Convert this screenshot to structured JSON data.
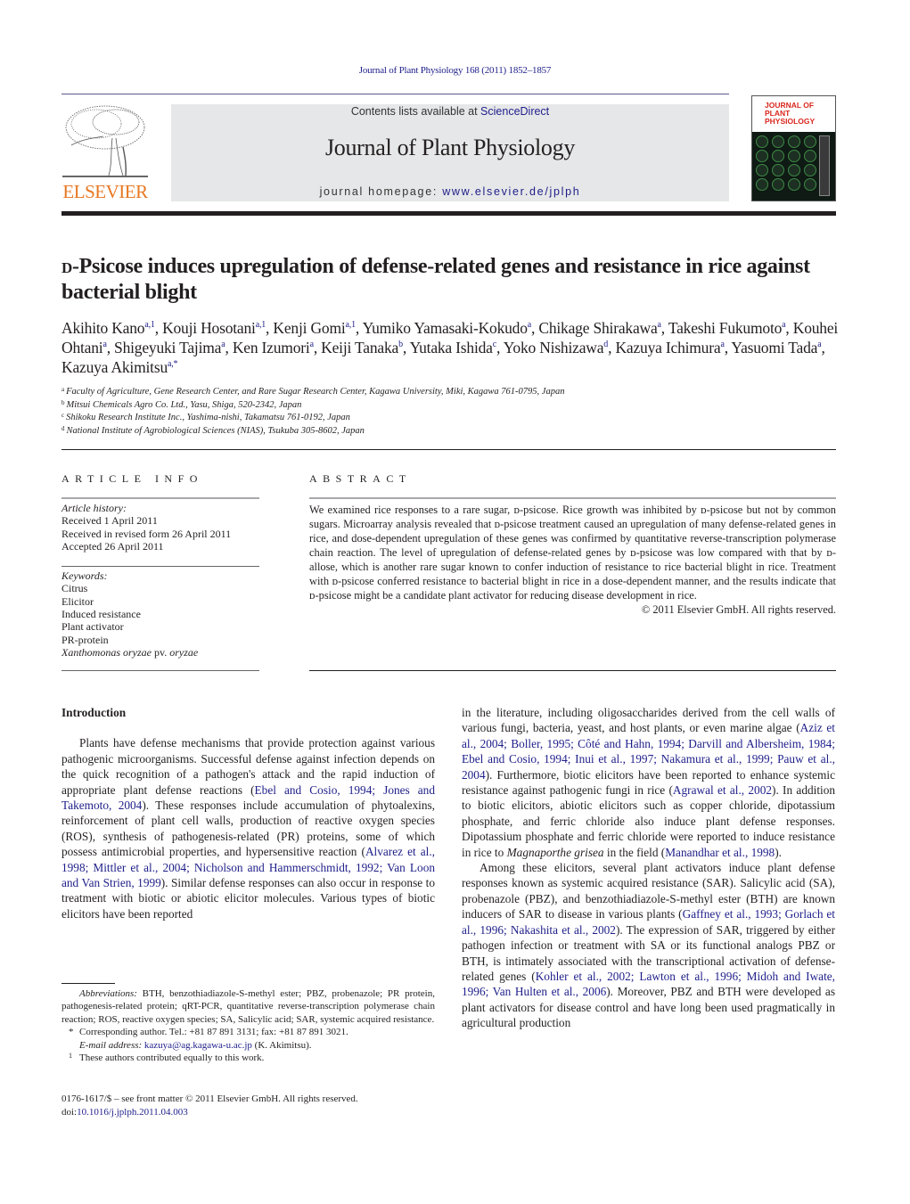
{
  "running_head": "Journal of Plant Physiology 168 (2011) 1852–1857",
  "masthead": {
    "publisher_logo": "ELSEVIER",
    "contents_prefix": "Contents lists available at ",
    "contents_link": "ScienceDirect",
    "journal_name": "Journal of Plant Physiology",
    "homepage_prefix": "journal homepage: ",
    "homepage_link": "www.elsevier.de/jplph",
    "cover_title": "JOURNAL OF PLANT PHYSIOLOGY"
  },
  "article": {
    "title_sc": "d",
    "title_rest": "-Psicose induces upregulation of defense-related genes and resistance in rice against bacterial blight",
    "authors": [
      {
        "name": "Akihito Kano",
        "aff": "a,1"
      },
      {
        "name": "Kouji Hosotani",
        "aff": "a,1"
      },
      {
        "name": "Kenji Gomi",
        "aff": "a,1"
      },
      {
        "name": "Yumiko Yamasaki-Kokudo",
        "aff": "a"
      },
      {
        "name": "Chikage Shirakawa",
        "aff": "a"
      },
      {
        "name": "Takeshi Fukumoto",
        "aff": "a"
      },
      {
        "name": "Kouhei Ohtani",
        "aff": "a"
      },
      {
        "name": "Shigeyuki Tajima",
        "aff": "a"
      },
      {
        "name": "Ken Izumori",
        "aff": "a"
      },
      {
        "name": "Keiji Tanaka",
        "aff": "b"
      },
      {
        "name": "Yutaka Ishida",
        "aff": "c"
      },
      {
        "name": "Yoko Nishizawa",
        "aff": "d"
      },
      {
        "name": "Kazuya Ichimura",
        "aff": "a"
      },
      {
        "name": "Yasuomi Tada",
        "aff": "a"
      },
      {
        "name": "Kazuya Akimitsu",
        "aff": "a,*"
      }
    ],
    "affiliations": [
      {
        "mark": "a",
        "text": "Faculty of Agriculture, Gene Research Center, and Rare Sugar Research Center, Kagawa University, Miki, Kagawa 761-0795, Japan"
      },
      {
        "mark": "b",
        "text": "Mitsui Chemicals Agro Co. Ltd., Yasu, Shiga, 520-2342, Japan"
      },
      {
        "mark": "c",
        "text": "Shikoku Research Institute Inc., Yashima-nishi, Takamatsu 761-0192, Japan"
      },
      {
        "mark": "d",
        "text": "National Institute of Agrobiological Sciences (NIAS), Tsukuba 305-8602, Japan"
      }
    ]
  },
  "article_info": {
    "heading": "ARTICLE INFO",
    "history_label": "Article history:",
    "history": [
      "Received 1 April 2011",
      "Received in revised form 26 April 2011",
      "Accepted 26 April 2011"
    ],
    "keywords_label": "Keywords:",
    "keywords": [
      "Citrus",
      "Elicitor",
      "Induced resistance",
      "Plant activator",
      "PR-protein"
    ],
    "keyword_last_italic": "Xanthomonas oryzae",
    "keyword_last_plain": " pv. ",
    "keyword_last_italic2": "oryzae"
  },
  "abstract": {
    "heading": "ABSTRACT",
    "text": "We examined rice responses to a rare sugar, ᴅ-psicose. Rice growth was inhibited by ᴅ-psicose but not by common sugars. Microarray analysis revealed that ᴅ-psicose treatment caused an upregulation of many defense-related genes in rice, and dose-dependent upregulation of these genes was confirmed by quantitative reverse-transcription polymerase chain reaction. The level of upregulation of defense-related genes by ᴅ-psicose was low compared with that by ᴅ-allose, which is another rare sugar known to confer induction of resistance to rice bacterial blight in rice. Treatment with ᴅ-psicose conferred resistance to bacterial blight in rice in a dose-dependent manner, and the results indicate that ᴅ-psicose might be a candidate plant activator for reducing disease development in rice.",
    "copyright": "© 2011 Elsevier GmbH. All rights reserved."
  },
  "body": {
    "intro_heading": "Introduction",
    "p1": [
      {
        "t": "Plants have defense mechanisms that provide protection against various pathogenic microorganisms. Successful defense against infection depends on the quick recognition of a pathogen's attack and the rapid induction of appropriate plant defense reactions ("
      },
      {
        "l": "Ebel and Cosio, 1994; Jones and Takemoto, 2004"
      },
      {
        "t": "). These responses include accumulation of phytoalexins, reinforcement of plant cell walls, production of reactive oxygen species (ROS), synthesis of pathogenesis-related (PR) proteins, some of which possess antimicrobial properties, and hypersensitive reaction ("
      },
      {
        "l": "Alvarez et al., 1998; Mittler et al., 2004; Nicholson and Hammerschmidt, 1992; Van Loon and Van Strien, 1999"
      },
      {
        "t": "). Similar defense responses can also occur in response to treatment with biotic or abiotic elicitor molecules. Various types of biotic elicitors have been reported in the literature, including oligosaccharides derived from the cell walls of various fungi, bacteria, yeast, and host plants, or even marine algae ("
      },
      {
        "l": "Aziz et al., 2004; Boller, 1995; Côté and Hahn, 1994; Darvill and Albersheim, 1984; Ebel and Cosio, 1994; Inui et al., 1997; Nakamura et al., 1999; Pauw et al., 2004"
      },
      {
        "t": "). Furthermore, biotic elicitors have been reported to enhance systemic resistance against pathogenic fungi in rice ("
      },
      {
        "l": "Agrawal et al., 2002"
      },
      {
        "t": "). In addition to biotic elicitors, abiotic elicitors such as copper chloride, dipotassium phosphate, and ferric chloride also induce plant defense responses. Dipotassium phosphate and ferric chloride were reported to induce resistance in rice to "
      },
      {
        "i": "Magnaporthe grisea"
      },
      {
        "t": " in the field ("
      },
      {
        "l": "Manandhar et al., 1998"
      },
      {
        "t": ")."
      }
    ],
    "p2": [
      {
        "t": "Among these elicitors, several plant activators induce plant defense responses known as systemic acquired resistance (SAR). Salicylic acid (SA), probenazole (PBZ), and benzothiadiazole-S-methyl ester (BTH) are known inducers of SAR to disease in various plants ("
      },
      {
        "l": "Gaffney et al., 1993; Gorlach et al., 1996; Nakashita et al., 2002"
      },
      {
        "t": "). The expression of SAR, triggered by either pathogen infection or treatment with SA or its functional analogs PBZ or BTH, is intimately associated with the transcriptional activation of defense-related genes ("
      },
      {
        "l": "Kohler et al., 2002; Lawton et al., 1996; Midoh and Iwate, 1996; Van Hulten et al., 2006"
      },
      {
        "t": "). Moreover, PBZ and BTH were developed as plant activators for disease control and have long been used pragmatically in agricultural production"
      }
    ]
  },
  "footnotes": {
    "abbr_label": "Abbreviations:",
    "abbr_text": " BTH, benzothiadiazole-S-methyl ester; PBZ, probenazole; PR protein, pathogenesis-related protein; qRT-PCR, quantitative reverse-transcription polymerase chain reaction; ROS, reactive oxygen species; SA, Salicylic acid; SAR, systemic acquired resistance.",
    "corr_mark": "*",
    "corr_text": "Corresponding author. Tel.: +81 87 891 3131; fax: +81 87 891 3021.",
    "email_label": "E-mail address:",
    "email": "kazuya@ag.kagawa-u.ac.jp",
    "email_suffix": " (K. Akimitsu).",
    "equal_mark": "1",
    "equal_text": "These authors contributed equally to this work."
  },
  "issn_line": "0176-1617/$ – see front matter © 2011 Elsevier GmbH. All rights reserved.",
  "doi_prefix": "doi:",
  "doi": "10.1016/j.jplph.2011.04.003"
}
